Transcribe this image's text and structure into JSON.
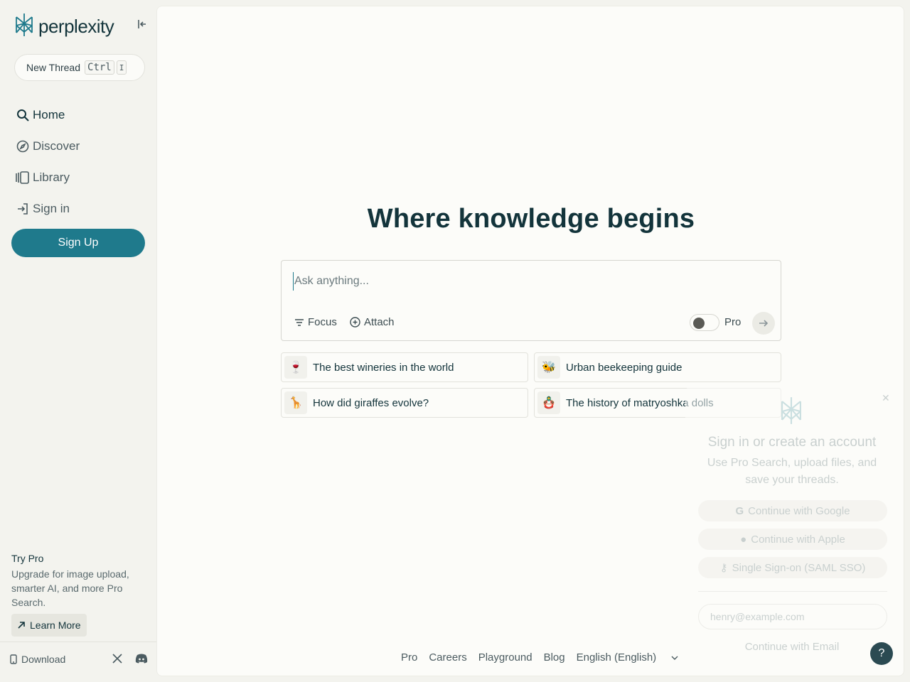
{
  "sidebar": {
    "brand": "perplexity",
    "new_thread": {
      "label": "New Thread",
      "key1": "Ctrl",
      "key2": "I"
    },
    "nav": [
      {
        "label": "Home",
        "icon": "search-icon"
      },
      {
        "label": "Discover",
        "icon": "compass-icon"
      },
      {
        "label": "Library",
        "icon": "library-icon"
      },
      {
        "label": "Sign in",
        "icon": "sign-in-icon"
      }
    ],
    "signup_label": "Sign Up",
    "try_pro": {
      "title": "Try Pro",
      "description": "Upgrade for image upload, smarter AI, and more Pro Search.",
      "learn_more": "Learn More"
    },
    "footer": {
      "download": "Download"
    }
  },
  "main": {
    "heading": "Where knowledge begins",
    "ask": {
      "placeholder": "Ask anything...",
      "focus_label": "Focus",
      "attach_label": "Attach",
      "pro_label": "Pro",
      "pro_enabled": false
    },
    "suggestions": [
      {
        "emoji": "🍷",
        "label": "The best wineries in the world"
      },
      {
        "emoji": "🐝",
        "label": "Urban beekeeping guide"
      },
      {
        "emoji": "🦒",
        "label": "How did giraffes evolve?"
      },
      {
        "emoji": "🪆",
        "label": "The history of matryoshka dolls"
      }
    ],
    "footer_links": [
      "Pro",
      "Careers",
      "Playground",
      "Blog",
      "English (English)"
    ]
  },
  "popup": {
    "title": "Sign in or create an account",
    "description": "Use Pro Search, upload files, and save your threads.",
    "google": "Continue with Google",
    "apple": "Continue with Apple",
    "sso": "Single Sign-on (SAML SSO)",
    "email_placeholder": "henry@example.com",
    "continue_email": "Continue with Email"
  },
  "help_label": "?",
  "colors": {
    "accent": "#1f7a8c",
    "text": "#13343b",
    "background": "#f3f3ee",
    "panel": "#fcfcf9"
  }
}
